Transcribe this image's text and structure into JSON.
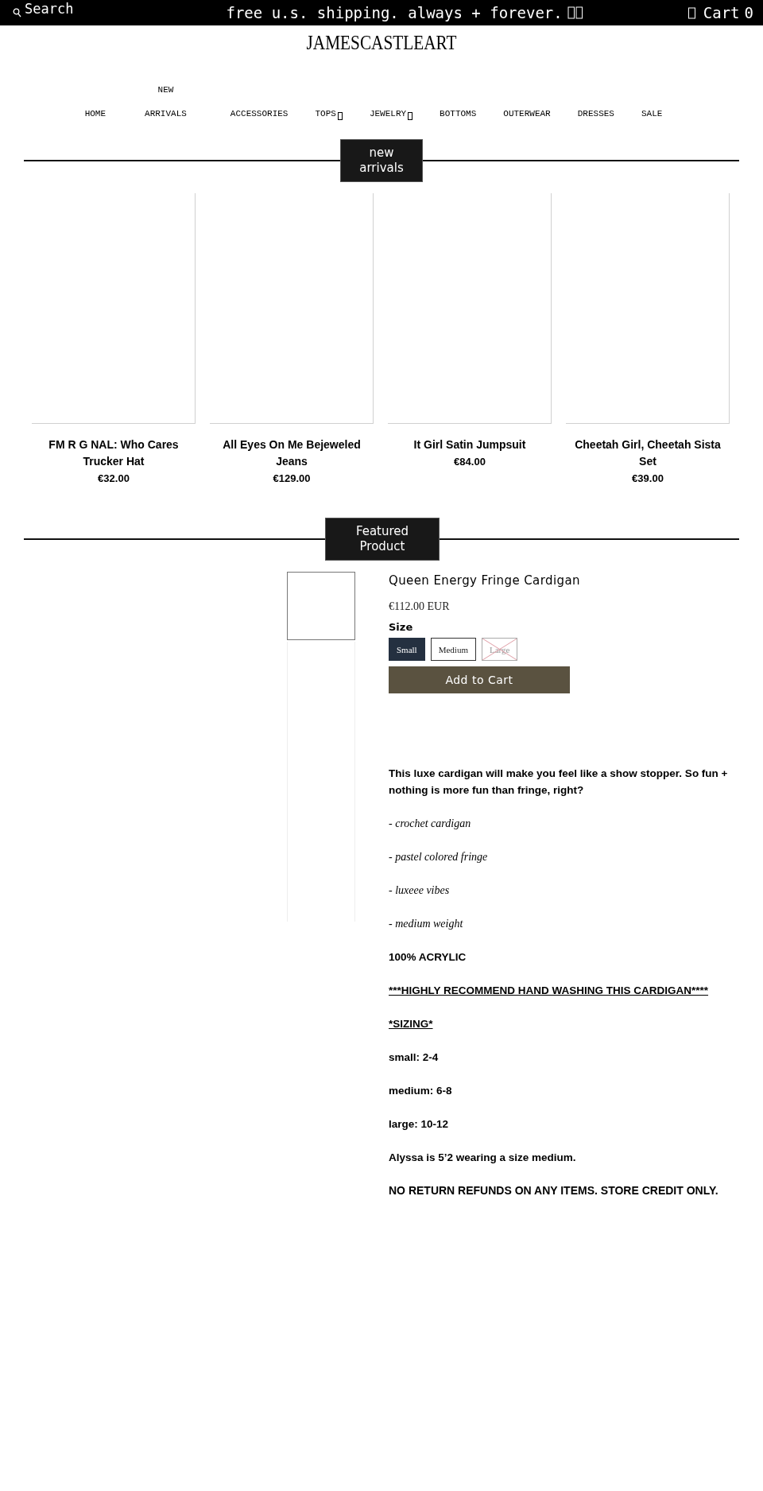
{
  "announcement_bar": {
    "search_label": "Search",
    "message": "free u.s. shipping. always + forever.",
    "cart_label": "Cart",
    "cart_count": "0"
  },
  "logo": "JAMESCASTLEART",
  "nav": [
    {
      "lines": [
        "HOME"
      ],
      "has_dropdown": false
    },
    {
      "lines": [
        "NEW",
        "ARRIVALS"
      ],
      "has_dropdown": false
    },
    {
      "lines": [
        "ACCESSORIES"
      ],
      "has_dropdown": false
    },
    {
      "lines": [
        "TOPS"
      ],
      "has_dropdown": true
    },
    {
      "lines": [
        "JEWELRY"
      ],
      "has_dropdown": true
    },
    {
      "lines": [
        "BOTTOMS"
      ],
      "has_dropdown": false
    },
    {
      "lines": [
        "OUTERWEAR"
      ],
      "has_dropdown": false
    },
    {
      "lines": [
        "DRESSES"
      ],
      "has_dropdown": false
    },
    {
      "lines": [
        "SALE"
      ],
      "has_dropdown": false
    }
  ],
  "new_arrivals": {
    "heading": "new arrivals",
    "products": [
      {
        "title": "FM  R G NAL: Who Cares Trucker Hat",
        "price": "€32.00"
      },
      {
        "title": "All Eyes On Me Bejeweled Jeans",
        "price": "€129.00"
      },
      {
        "title": "It Girl Satin Jumpsuit",
        "price": "€84.00"
      },
      {
        "title": "Cheetah Girl, Cheetah Sista Set",
        "price": "€39.00"
      }
    ]
  },
  "featured": {
    "heading": "Featured Product",
    "thumbnails": [
      {
        "selected": true
      },
      {
        "selected": false
      },
      {
        "selected": false
      },
      {
        "selected": false
      },
      {
        "selected": false
      }
    ],
    "title": "Queen Energy Fringe Cardigan",
    "price": "€112.00 EUR",
    "size_label": "Size",
    "sizes": [
      {
        "label": "Small",
        "selected": true,
        "disabled": false
      },
      {
        "label": "Medium",
        "selected": false,
        "disabled": false
      },
      {
        "label": "Large",
        "selected": false,
        "disabled": true
      }
    ],
    "add_to_cart": "Add to Cart",
    "description": [
      {
        "kind": "plain",
        "text": "This luxe cardigan will make you feel like a show stopper. So fun + nothing is more fun than fringe, right?"
      },
      {
        "kind": "italic",
        "text": "- crochet cardigan"
      },
      {
        "kind": "italic",
        "text": "- pastel colored fringe"
      },
      {
        "kind": "italic",
        "text": "- luxeee vibes"
      },
      {
        "kind": "italic",
        "text": "- medium weight"
      },
      {
        "kind": "plain",
        "text": "100% ACRYLIC"
      },
      {
        "kind": "underline",
        "text": "***HIGHLY RECOMMEND HAND WASHING THIS CARDIGAN****"
      },
      {
        "kind": "underline",
        "text": "*SIZING*"
      },
      {
        "kind": "plain",
        "text": "small: 2-4"
      },
      {
        "kind": "plain",
        "text": "medium: 6-8"
      },
      {
        "kind": "plain",
        "text": "large: 10-12"
      },
      {
        "kind": "plain",
        "text": "Alyssa is 5’2 wearing a size medium."
      },
      {
        "kind": "strong",
        "text": "NO RETURN REFUNDS ON ANY ITEMS. STORE CREDIT ONLY."
      }
    ]
  }
}
